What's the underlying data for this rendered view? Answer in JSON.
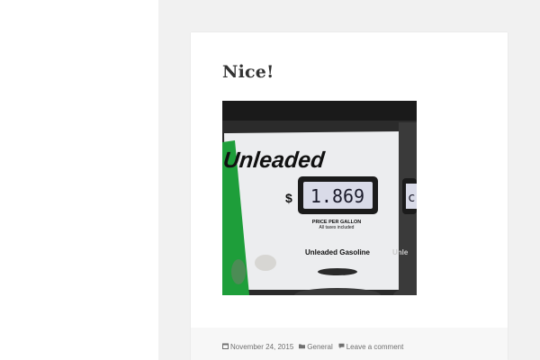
{
  "post": {
    "title": "Nice!",
    "photo": {
      "brand_label": "Unleaded",
      "currency_symbol": "$",
      "price_display": "1.869",
      "second_pump_digit": "c",
      "price_caption_line1": "PRICE PER GALLON",
      "price_caption_line2": "All taxes included",
      "grade_label": "Unleaded Gasoline",
      "grade_label_partial": "Unle"
    }
  },
  "footer": {
    "date": "November 24, 2015",
    "category": "General",
    "comments": "Leave a comment"
  },
  "icons": {
    "date_icon": "calendar-icon",
    "category_icon": "folder-icon",
    "comment_icon": "comment-icon"
  },
  "colors": {
    "page_background": "#f1f1f1",
    "card_background": "#ffffff",
    "footer_background": "#f7f7f7",
    "title_color": "#333333",
    "meta_color": "#707070",
    "pump_green": "#1e9e3a"
  }
}
